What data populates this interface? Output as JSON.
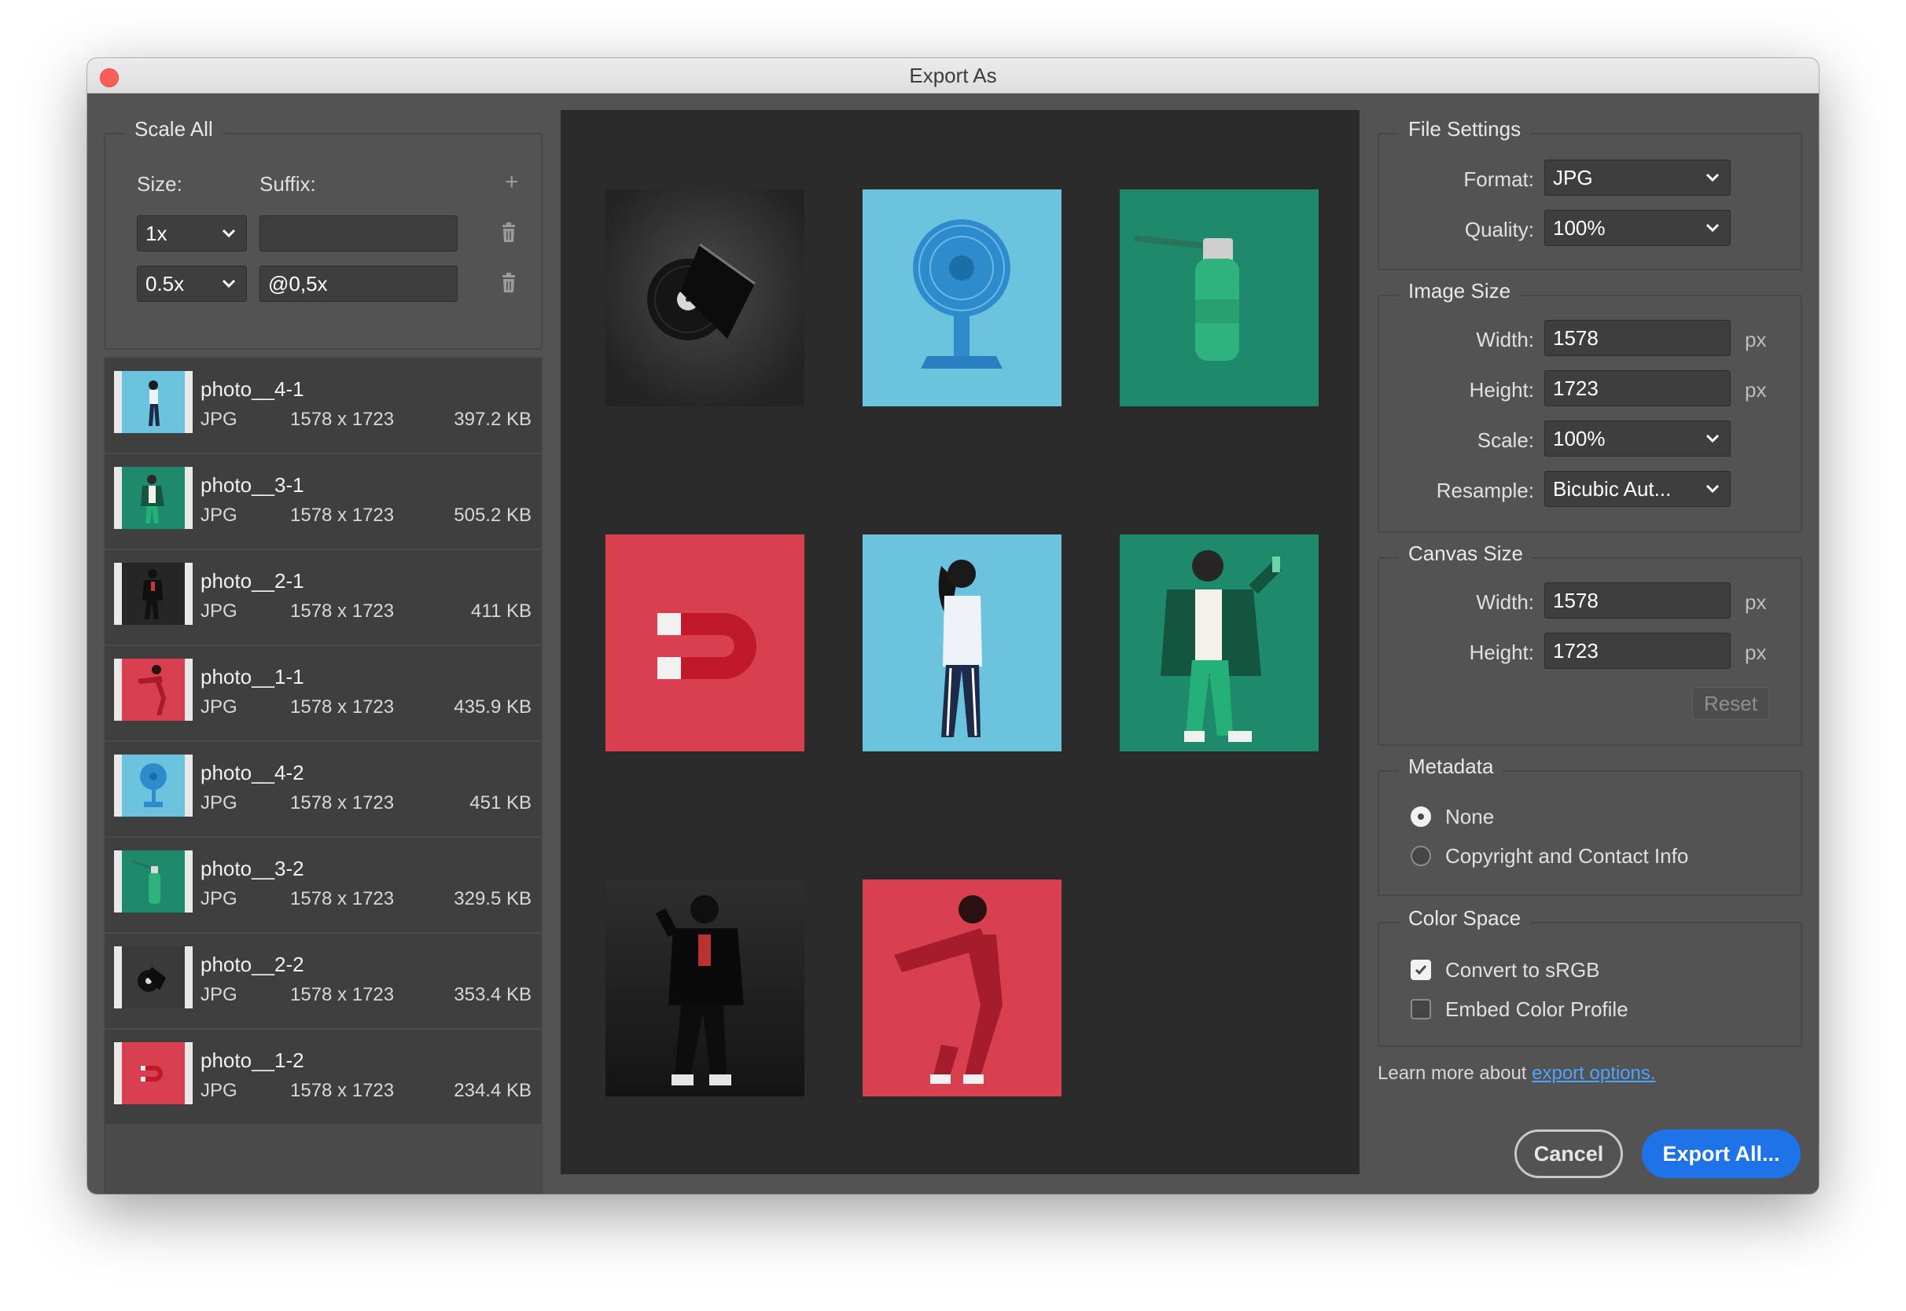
{
  "window": {
    "title": "Export As"
  },
  "scale_all": {
    "legend": "Scale All",
    "size_label": "Size:",
    "suffix_label": "Suffix:",
    "rows": [
      {
        "size": "1x",
        "suffix": ""
      },
      {
        "size": "0.5x",
        "suffix": "@0,5x"
      }
    ]
  },
  "assets": [
    {
      "name": "photo__4-1",
      "format": "JPG",
      "dimensions": "1578 x 1723",
      "size": "397.2 KB"
    },
    {
      "name": "photo__3-1",
      "format": "JPG",
      "dimensions": "1578 x 1723",
      "size": "505.2 KB"
    },
    {
      "name": "photo__2-1",
      "format": "JPG",
      "dimensions": "1578 x 1723",
      "size": "411 KB"
    },
    {
      "name": "photo__1-1",
      "format": "JPG",
      "dimensions": "1578 x 1723",
      "size": "435.9 KB"
    },
    {
      "name": "photo__4-2",
      "format": "JPG",
      "dimensions": "1578 x 1723",
      "size": "451 KB"
    },
    {
      "name": "photo__3-2",
      "format": "JPG",
      "dimensions": "1578 x 1723",
      "size": "329.5 KB"
    },
    {
      "name": "photo__2-2",
      "format": "JPG",
      "dimensions": "1578 x 1723",
      "size": "353.4 KB"
    },
    {
      "name": "photo__1-2",
      "format": "JPG",
      "dimensions": "1578 x 1723",
      "size": "234.4 KB"
    }
  ],
  "file_settings": {
    "legend": "File Settings",
    "format_label": "Format:",
    "format": "JPG",
    "quality_label": "Quality:",
    "quality": "100%"
  },
  "image_size": {
    "legend": "Image Size",
    "width_label": "Width:",
    "width": "1578",
    "height_label": "Height:",
    "height": "1723",
    "scale_label": "Scale:",
    "scale": "100%",
    "resample_label": "Resample:",
    "resample": "Bicubic Aut...",
    "unit": "px"
  },
  "canvas_size": {
    "legend": "Canvas Size",
    "width_label": "Width:",
    "width": "1578",
    "height_label": "Height:",
    "height": "1723",
    "unit": "px",
    "reset": "Reset"
  },
  "metadata": {
    "legend": "Metadata",
    "options": [
      {
        "label": "None",
        "selected": true
      },
      {
        "label": "Copyright and Contact Info",
        "selected": false
      }
    ]
  },
  "color_space": {
    "legend": "Color Space",
    "convert_srgb": {
      "label": "Convert to sRGB",
      "checked": true
    },
    "embed_profile": {
      "label": "Embed Color Profile",
      "checked": false
    }
  },
  "footer": {
    "learn_prefix": "Learn more about",
    "learn_link": "export options.",
    "cancel": "Cancel",
    "export": "Export All..."
  },
  "colors": {
    "accent": "#1f73e8",
    "link": "#4ea3ff",
    "panel": "#535353",
    "preview_bg": "#2a2a2a",
    "teal": "#1f8a6b",
    "sky": "#6cc3de",
    "red": "#d9404f",
    "dark": "#2b2b2b"
  }
}
